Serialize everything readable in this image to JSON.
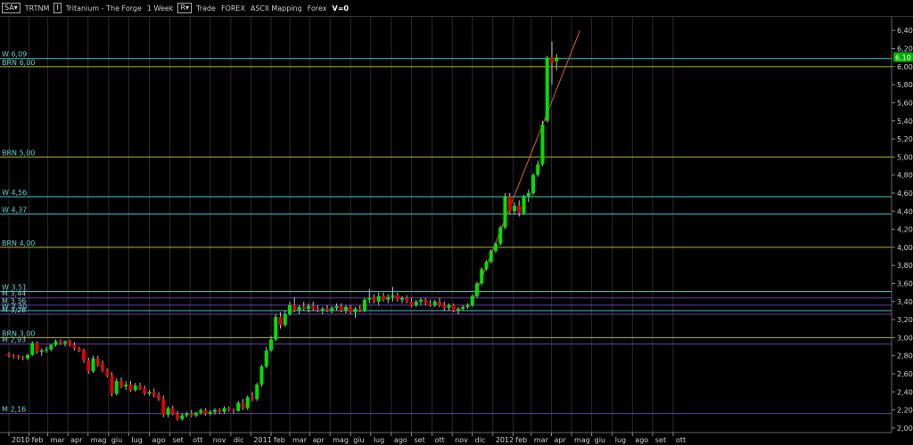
{
  "toolbar": {
    "symbol_select": "SA",
    "symbol_code": "TRTNM",
    "tag_i": "I",
    "title": "Tritanium - The Forge",
    "period": "1 Week",
    "tag_r": "R",
    "mode_1": "Trade",
    "mode_2": "FOREX",
    "mode_3": "ASCII Mapping",
    "mode_4": "Forex",
    "volume": "V=0"
  },
  "colors": {
    "background": "#000000",
    "up_candle": "#00e000",
    "down_candle": "#e00000",
    "cyan_line": "#3fc8c8",
    "yellow_line": "#b8b820",
    "purple_line": "#6040a0",
    "trend_line": "#e06020",
    "grid": "#2a2a2a",
    "axis_text": "#d0d0d0"
  },
  "chart_data": {
    "type": "candlestick",
    "ylim": [
      1.95,
      6.55
    ],
    "y_ticks": [
      "6,40",
      "6,20",
      "6,00",
      "5,80",
      "5,60",
      "5,40",
      "5,20",
      "5,00",
      "4,80",
      "4,60",
      "4,40",
      "4,20",
      "4,00",
      "3,80",
      "3,60",
      "3,40",
      "3,20",
      "3,00",
      "2,80",
      "2,60",
      "2,40",
      "2,20",
      "2,00"
    ],
    "y_tick_values": [
      6.4,
      6.2,
      6.0,
      5.8,
      5.6,
      5.4,
      5.2,
      5.0,
      4.8,
      4.6,
      4.4,
      4.2,
      4.0,
      3.8,
      3.6,
      3.4,
      3.2,
      3.0,
      2.8,
      2.6,
      2.4,
      2.2,
      2.0
    ],
    "x_labels": [
      "2010",
      "feb",
      "mar",
      "apr",
      "mag",
      "giu",
      "lug",
      "ago",
      "set",
      "ott",
      "nov",
      "dic",
      "2011",
      "feb",
      "mar",
      "apr",
      "mag",
      "giu",
      "lug",
      "ago",
      "set",
      "ott",
      "nov",
      "dic",
      "2012",
      "feb",
      "mar",
      "apr",
      "mag",
      "giu",
      "lug",
      "ago",
      "set",
      "ott"
    ],
    "x_label_week": [
      0,
      4.3,
      8.3,
      12.6,
      16.9,
      21.3,
      25.6,
      30,
      34.4,
      38.7,
      43,
      47.4,
      51.7,
      56,
      60,
      64.3,
      68.6,
      73,
      77.3,
      81.7,
      86,
      90.4,
      94.7,
      99,
      103.4,
      107.7,
      111.6,
      115.9,
      120.2,
      124.5,
      128.9,
      133.2,
      137.5,
      141.9
    ],
    "current_price": "6,10",
    "current_value": 6.1,
    "levels": [
      {
        "label": "W 6,09",
        "value": 6.09,
        "kind": "cyan"
      },
      {
        "label": "BRN 6,00",
        "value": 6.0,
        "kind": "yellow"
      },
      {
        "label": "BRN 5,00",
        "value": 5.0,
        "kind": "yellow"
      },
      {
        "label": "W 4,56",
        "value": 4.56,
        "kind": "cyan"
      },
      {
        "label": "W 4,37",
        "value": 4.37,
        "kind": "cyan"
      },
      {
        "label": "BRN 4,00",
        "value": 4.0,
        "kind": "yellow"
      },
      {
        "label": "W 3,51",
        "value": 3.51,
        "kind": "cyan"
      },
      {
        "label": "M 3,44",
        "value": 3.44,
        "kind": "purple"
      },
      {
        "label": "M 3,36",
        "value": 3.36,
        "kind": "purple"
      },
      {
        "label": "W 3,30",
        "value": 3.3,
        "kind": "cyan"
      },
      {
        "label": "M 3,26",
        "value": 3.26,
        "kind": "purple"
      },
      {
        "label": "BRN 3,00",
        "value": 3.0,
        "kind": "yellow"
      },
      {
        "label": "M 2,93",
        "value": 2.93,
        "kind": "purple"
      },
      {
        "label": "M 2,16",
        "value": 2.16,
        "kind": "purple"
      }
    ],
    "trendline": {
      "from": {
        "week": 99,
        "value": 3.4
      },
      "to": {
        "week": 122,
        "value": 6.4
      }
    },
    "candles": [
      [
        2.82,
        2.84,
        2.78,
        2.8
      ],
      [
        2.8,
        2.82,
        2.77,
        2.79
      ],
      [
        2.79,
        2.81,
        2.76,
        2.78
      ],
      [
        2.78,
        2.8,
        2.75,
        2.77
      ],
      [
        2.77,
        2.82,
        2.75,
        2.81
      ],
      [
        2.81,
        2.96,
        2.8,
        2.94
      ],
      [
        2.94,
        2.96,
        2.82,
        2.84
      ],
      [
        2.84,
        2.88,
        2.8,
        2.86
      ],
      [
        2.86,
        2.9,
        2.83,
        2.87
      ],
      [
        2.87,
        2.93,
        2.85,
        2.92
      ],
      [
        2.92,
        2.98,
        2.9,
        2.96
      ],
      [
        2.96,
        2.98,
        2.92,
        2.94
      ],
      [
        2.94,
        2.97,
        2.9,
        2.96
      ],
      [
        2.96,
        2.98,
        2.9,
        2.92
      ],
      [
        2.92,
        2.95,
        2.86,
        2.88
      ],
      [
        2.88,
        2.9,
        2.84,
        2.86
      ],
      [
        2.86,
        2.88,
        2.72,
        2.75
      ],
      [
        2.75,
        2.78,
        2.6,
        2.63
      ],
      [
        2.63,
        2.8,
        2.61,
        2.77
      ],
      [
        2.77,
        2.8,
        2.68,
        2.7
      ],
      [
        2.7,
        2.75,
        2.62,
        2.64
      ],
      [
        2.64,
        2.66,
        2.56,
        2.58
      ],
      [
        2.58,
        2.62,
        2.35,
        2.38
      ],
      [
        2.38,
        2.55,
        2.36,
        2.52
      ],
      [
        2.52,
        2.56,
        2.44,
        2.46
      ],
      [
        2.46,
        2.52,
        2.42,
        2.48
      ],
      [
        2.48,
        2.52,
        2.4,
        2.42
      ],
      [
        2.42,
        2.5,
        2.4,
        2.47
      ],
      [
        2.47,
        2.5,
        2.42,
        2.44
      ],
      [
        2.44,
        2.47,
        2.36,
        2.38
      ],
      [
        2.38,
        2.42,
        2.36,
        2.4
      ],
      [
        2.4,
        2.44,
        2.34,
        2.36
      ],
      [
        2.36,
        2.4,
        2.3,
        2.32
      ],
      [
        2.32,
        2.36,
        2.12,
        2.15
      ],
      [
        2.15,
        2.24,
        2.12,
        2.22
      ],
      [
        2.22,
        2.25,
        2.14,
        2.16
      ],
      [
        2.16,
        2.19,
        2.08,
        2.1
      ],
      [
        2.1,
        2.16,
        2.08,
        2.14
      ],
      [
        2.14,
        2.18,
        2.12,
        2.16
      ],
      [
        2.16,
        2.2,
        2.12,
        2.14
      ],
      [
        2.14,
        2.18,
        2.12,
        2.17
      ],
      [
        2.17,
        2.22,
        2.15,
        2.2
      ],
      [
        2.2,
        2.22,
        2.14,
        2.16
      ],
      [
        2.16,
        2.2,
        2.14,
        2.18
      ],
      [
        2.18,
        2.22,
        2.15,
        2.2
      ],
      [
        2.2,
        2.22,
        2.16,
        2.18
      ],
      [
        2.18,
        2.24,
        2.16,
        2.22
      ],
      [
        2.22,
        2.24,
        2.18,
        2.2
      ],
      [
        2.2,
        2.22,
        2.16,
        2.19
      ],
      [
        2.19,
        2.3,
        2.18,
        2.28
      ],
      [
        2.28,
        2.32,
        2.2,
        2.22
      ],
      [
        2.22,
        2.36,
        2.2,
        2.34
      ],
      [
        2.34,
        2.4,
        2.3,
        2.32
      ],
      [
        2.32,
        2.5,
        2.3,
        2.48
      ],
      [
        2.48,
        2.7,
        2.46,
        2.68
      ],
      [
        2.68,
        2.9,
        2.66,
        2.86
      ],
      [
        2.86,
        3.02,
        2.84,
        2.98
      ],
      [
        2.98,
        3.26,
        2.96,
        3.23
      ],
      [
        3.23,
        3.28,
        3.1,
        3.14
      ],
      [
        3.14,
        3.3,
        3.12,
        3.26
      ],
      [
        3.26,
        3.4,
        3.24,
        3.36
      ],
      [
        3.36,
        3.45,
        3.28,
        3.3
      ],
      [
        3.3,
        3.36,
        3.26,
        3.34
      ],
      [
        3.34,
        3.4,
        3.3,
        3.32
      ],
      [
        3.32,
        3.38,
        3.28,
        3.35
      ],
      [
        3.35,
        3.4,
        3.3,
        3.32
      ],
      [
        3.32,
        3.36,
        3.28,
        3.3
      ],
      [
        3.3,
        3.34,
        3.26,
        3.32
      ],
      [
        3.32,
        3.36,
        3.28,
        3.3
      ],
      [
        3.3,
        3.35,
        3.27,
        3.33
      ],
      [
        3.33,
        3.38,
        3.3,
        3.35
      ],
      [
        3.35,
        3.38,
        3.28,
        3.3
      ],
      [
        3.3,
        3.36,
        3.27,
        3.34
      ],
      [
        3.34,
        3.36,
        3.26,
        3.28
      ],
      [
        3.28,
        3.34,
        3.22,
        3.32
      ],
      [
        3.32,
        3.36,
        3.28,
        3.3
      ],
      [
        3.3,
        3.44,
        3.28,
        3.42
      ],
      [
        3.42,
        3.54,
        3.38,
        3.44
      ],
      [
        3.44,
        3.48,
        3.38,
        3.4
      ],
      [
        3.4,
        3.5,
        3.36,
        3.46
      ],
      [
        3.46,
        3.5,
        3.4,
        3.42
      ],
      [
        3.42,
        3.48,
        3.38,
        3.45
      ],
      [
        3.45,
        3.56,
        3.4,
        3.47
      ],
      [
        3.47,
        3.5,
        3.4,
        3.42
      ],
      [
        3.42,
        3.46,
        3.38,
        3.44
      ],
      [
        3.44,
        3.47,
        3.38,
        3.4
      ],
      [
        3.4,
        3.44,
        3.34,
        3.36
      ],
      [
        3.36,
        3.42,
        3.34,
        3.4
      ],
      [
        3.4,
        3.44,
        3.36,
        3.42
      ],
      [
        3.42,
        3.44,
        3.36,
        3.38
      ],
      [
        3.38,
        3.42,
        3.34,
        3.36
      ],
      [
        3.36,
        3.42,
        3.34,
        3.4
      ],
      [
        3.4,
        3.44,
        3.34,
        3.36
      ],
      [
        3.36,
        3.4,
        3.3,
        3.33
      ],
      [
        3.33,
        3.38,
        3.3,
        3.36
      ],
      [
        3.36,
        3.38,
        3.28,
        3.3
      ],
      [
        3.3,
        3.34,
        3.26,
        3.32
      ],
      [
        3.32,
        3.36,
        3.3,
        3.34
      ],
      [
        3.34,
        3.38,
        3.32,
        3.36
      ],
      [
        3.36,
        3.48,
        3.34,
        3.46
      ],
      [
        3.46,
        3.62,
        3.44,
        3.6
      ],
      [
        3.6,
        3.78,
        3.58,
        3.76
      ],
      [
        3.76,
        3.86,
        3.74,
        3.84
      ],
      [
        3.84,
        3.98,
        3.82,
        3.96
      ],
      [
        3.96,
        4.06,
        3.94,
        4.04
      ],
      [
        4.04,
        4.24,
        4.02,
        4.22
      ],
      [
        4.22,
        4.6,
        4.2,
        4.56
      ],
      [
        4.56,
        4.6,
        4.36,
        4.4
      ],
      [
        4.4,
        4.5,
        4.36,
        4.46
      ],
      [
        4.46,
        4.52,
        4.34,
        4.38
      ],
      [
        4.38,
        4.58,
        4.36,
        4.56
      ],
      [
        4.56,
        4.64,
        4.5,
        4.6
      ],
      [
        4.6,
        4.82,
        4.58,
        4.8
      ],
      [
        4.8,
        4.96,
        4.78,
        4.92
      ],
      [
        4.92,
        5.4,
        4.9,
        5.36
      ],
      [
        5.4,
        6.12,
        5.38,
        6.1
      ],
      [
        6.1,
        6.28,
        5.8,
        6.04
      ],
      [
        6.06,
        6.14,
        5.96,
        6.1
      ]
    ]
  }
}
